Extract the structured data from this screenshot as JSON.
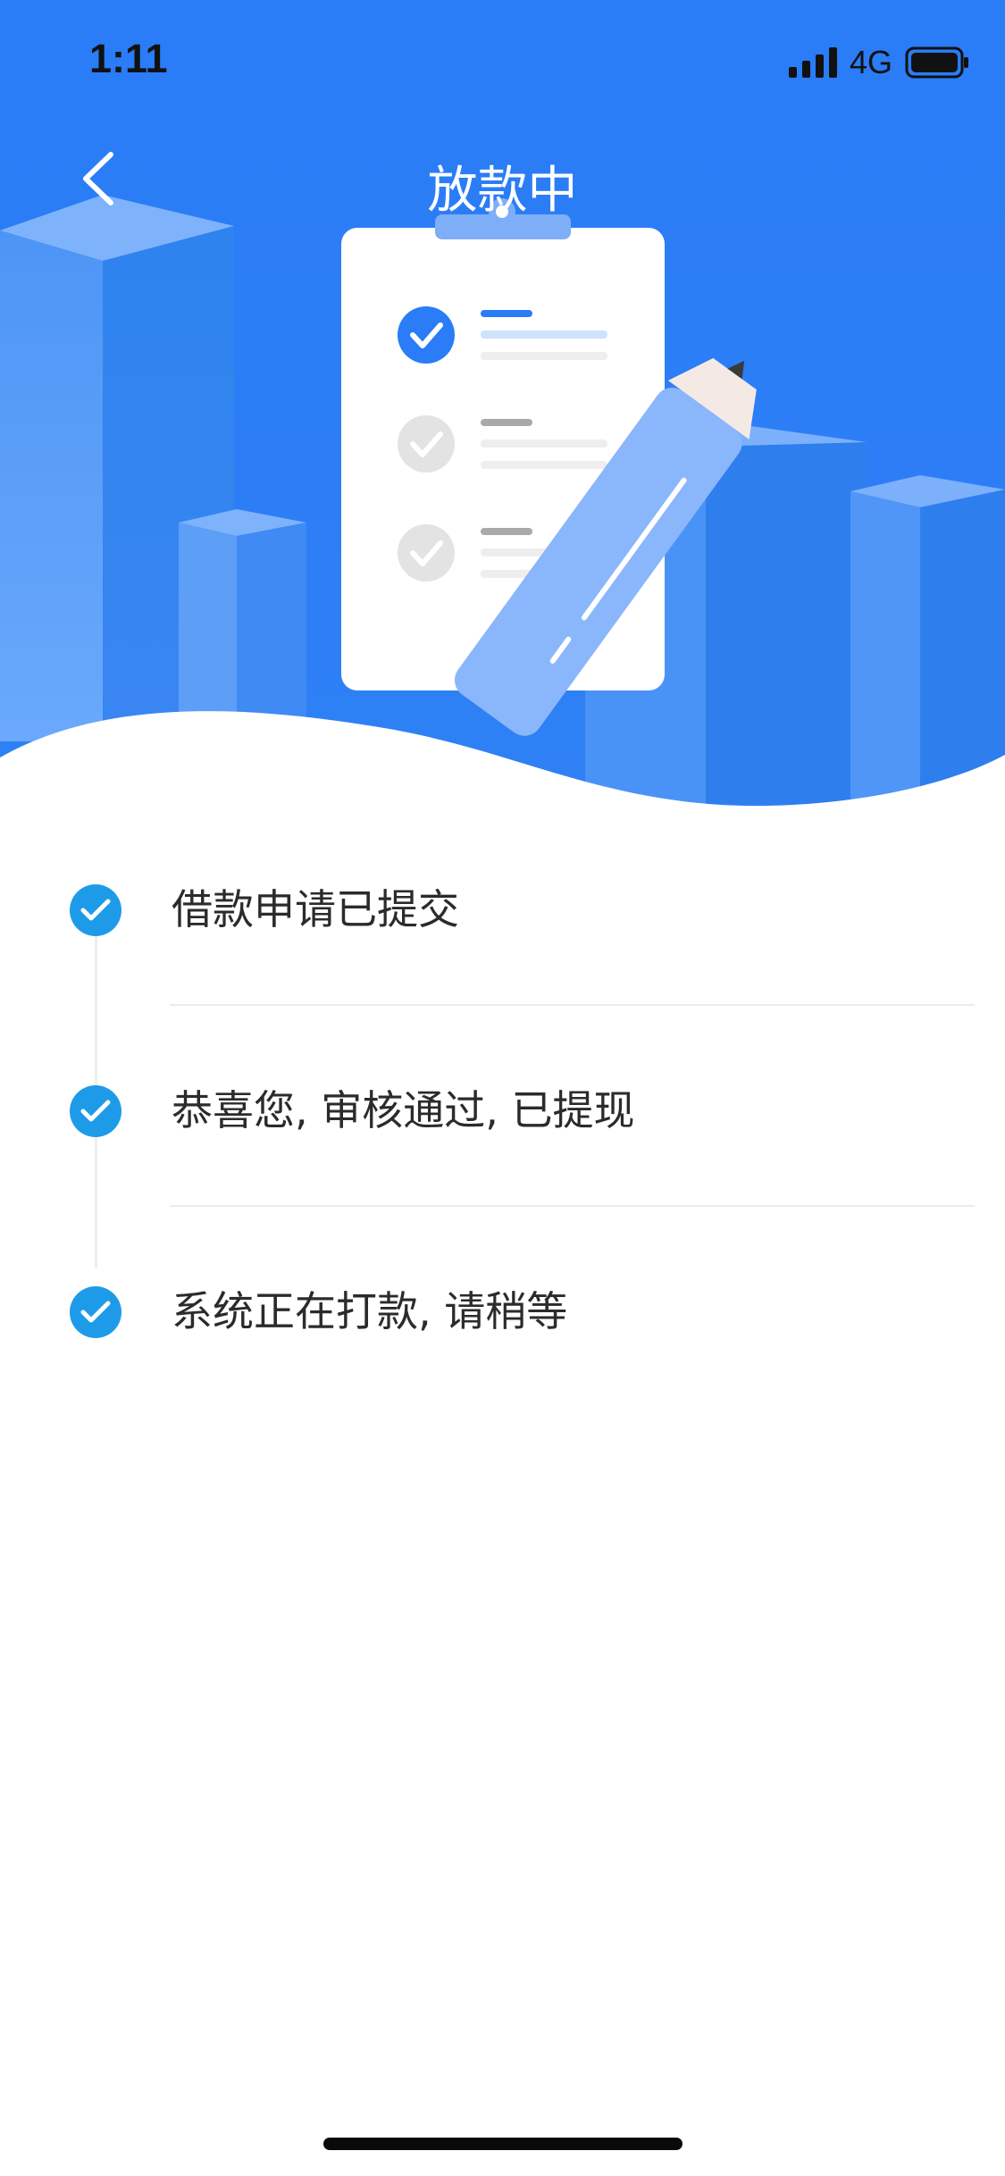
{
  "status_bar": {
    "time": "1:11",
    "network": "4G",
    "signal_icon": "cellular-signal-icon",
    "battery_icon": "battery-icon"
  },
  "nav": {
    "title": "放款中",
    "back_icon": "chevron-left-icon"
  },
  "hero": {
    "illustration": "clipboard-checklist-with-pencil",
    "background_color": "#2a7cf7"
  },
  "steps": [
    {
      "label": "借款申请已提交",
      "completed": true
    },
    {
      "label": "恭喜您, 审核通过, 已提现",
      "completed": true
    },
    {
      "label": "系统正在打款, 请稍等",
      "completed": true
    }
  ],
  "colors": {
    "accent": "#2a7cf7",
    "step_check": "#1e9be8",
    "text": "#2b2b2b"
  }
}
